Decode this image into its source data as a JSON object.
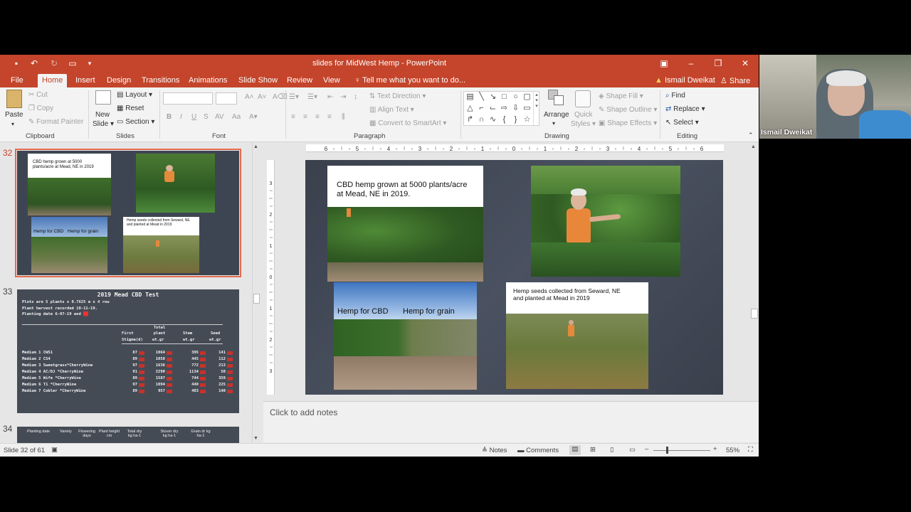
{
  "window": {
    "title": "slides for MidWest Hemp  -  PowerPoint",
    "colors": {
      "accent": "#c4452b",
      "selection": "#e46b50"
    }
  },
  "tabs": [
    {
      "label": "File"
    },
    {
      "label": "Home"
    },
    {
      "label": "Insert"
    },
    {
      "label": "Design"
    },
    {
      "label": "Transitions"
    },
    {
      "label": "Animations"
    },
    {
      "label": "Slide Show"
    },
    {
      "label": "Review"
    },
    {
      "label": "View"
    }
  ],
  "tell_me": "Tell me what you want to do...",
  "user": {
    "name": "Ismail Dweikat",
    "share": "Share"
  },
  "ribbon": {
    "clipboard": {
      "paste": "Paste",
      "cut": "Cut",
      "copy": "Copy",
      "format_painter": "Format Painter",
      "label": "Clipboard"
    },
    "slides": {
      "new_slide": "New",
      "new_slide2": "Slide",
      "layout": "Layout",
      "reset": "Reset",
      "section": "Section",
      "label": "Slides"
    },
    "font": {
      "bold": "B",
      "italic": "I",
      "underline": "U",
      "strike": "S",
      "label": "Font"
    },
    "paragraph": {
      "text_direction": "Text Direction",
      "align_text": "Align Text",
      "smartart": "Convert to SmartArt",
      "label": "Paragraph"
    },
    "drawing": {
      "arrange": "Arrange",
      "quick_styles": "Quick",
      "quick_styles2": "Styles",
      "shape_fill": "Shape Fill",
      "shape_outline": "Shape Outline",
      "shape_effects": "Shape Effects",
      "label": "Drawing"
    },
    "editing": {
      "find": "Find",
      "replace": "Replace",
      "select": "Select",
      "label": "Editing"
    }
  },
  "thumbnails": [
    {
      "number": "32"
    },
    {
      "number": "33"
    },
    {
      "number": "34"
    }
  ],
  "thumb32": {
    "caption1": "CBD hemp grown at 5000 plants/acre at Mead, NE in 2019",
    "caption2": "Hemp for CBD",
    "caption3": "Hemp for grain",
    "caption4": "Hemp seeds collected from Seward, NE and planted at Mead in 2019"
  },
  "thumb33": {
    "title": "2019 Mead CBD Test",
    "info1": "Plots are 5 plants x 0.7625 m x 4 row",
    "info2": "Plant harvest recorded 10-11-19.",
    "info3": "Planting date 6-07-19 and",
    "headers": [
      "First",
      "Total plant",
      "Stem",
      "Seed"
    ],
    "subheaders": [
      "Stigma(d)",
      "wt.gr",
      "wt.gr",
      "wt.gr"
    ],
    "rows": [
      {
        "name": "Medium 1 CWS1",
        "v": [
          "87",
          "1064",
          "395",
          "141"
        ]
      },
      {
        "name": "Medium 2 CS4",
        "v": [
          "89",
          "1058",
          "445",
          "112"
        ]
      },
      {
        "name": "Medium 3 Sweetgrass*CherryWine",
        "v": [
          "97",
          "1636",
          "772",
          "213"
        ]
      },
      {
        "name": "Medium 4 AC/DJ *CherryWine",
        "v": [
          "91",
          "2290",
          "1134",
          "50"
        ]
      },
      {
        "name": "Medium 5 Wife *CherryWine",
        "v": [
          "89",
          "1587",
          "744",
          "359"
        ]
      },
      {
        "name": "Medium 6 T1  *CherryWine",
        "v": [
          "97",
          "1094",
          "440",
          "225"
        ]
      },
      {
        "name": "Medium 7 Cobler *CherryWine",
        "v": [
          "89",
          "957",
          "403",
          "140"
        ]
      }
    ]
  },
  "thumb34": {
    "headers": [
      "Planting date",
      "Variety",
      "Flowering days",
      "Plant height cm",
      "Total dry kg ha-1",
      "Stover dry kg ha-1",
      "Grain dr kg ha-1"
    ]
  },
  "ruler_labels": [
    "6",
    "5",
    "4",
    "3",
    "2",
    "1",
    "0",
    "1",
    "2",
    "3",
    "4",
    "5",
    "6"
  ],
  "slide": {
    "caption1": "CBD hemp grown at 5000 plants/acre",
    "caption1b": "at Mead, NE in 2019.",
    "caption2": "Hemp for CBD",
    "caption3": "Hemp for grain",
    "caption4": "Hemp seeds collected from Seward, NE",
    "caption4b": "and planted at Mead in 2019"
  },
  "notes_placeholder": "Click to add notes",
  "status": {
    "slide_info": "Slide 32 of 61",
    "notes": "Notes",
    "comments": "Comments",
    "zoom": "55%"
  }
}
